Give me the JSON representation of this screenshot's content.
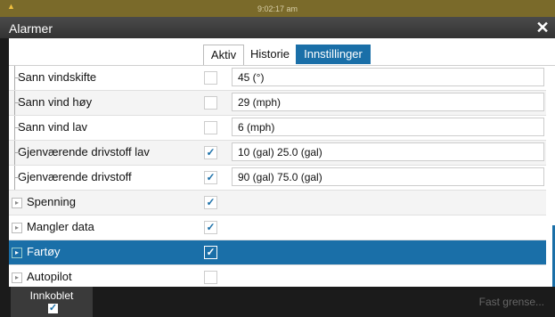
{
  "status_bar": {
    "time": "9:02:17 am",
    "warning_icon": "warning-icon"
  },
  "window": {
    "title": "Alarmer",
    "close_icon": "close-icon"
  },
  "tabs": [
    {
      "label": "Aktiv"
    },
    {
      "label": "Historie"
    },
    {
      "label": "Innstillinger",
      "active": true
    }
  ],
  "rows": [
    {
      "label": "Sann vindskifte",
      "checked": false,
      "value": "45 (°)",
      "sub": true
    },
    {
      "label": "Sann vind høy",
      "checked": false,
      "value": "29 (mph)",
      "sub": true
    },
    {
      "label": "Sann vind lav",
      "checked": false,
      "value": "6 (mph)",
      "sub": true
    },
    {
      "label": "Gjenværende drivstoff lav",
      "checked": true,
      "value": "10 (gal)  25.0 (gal)",
      "sub": true
    },
    {
      "label": "Gjenværende drivstoff",
      "checked": true,
      "value": "90 (gal)  75.0 (gal)",
      "sub": true
    },
    {
      "label": "Spenning",
      "checked": true,
      "value": ""
    },
    {
      "label": "Mangler data",
      "checked": true,
      "value": ""
    },
    {
      "label": "Fartøy",
      "checked": true,
      "value": "",
      "selected": true
    },
    {
      "label": "Autopilot",
      "checked": false,
      "value": ""
    }
  ],
  "bottom_bar": {
    "enabled_label": "Innkoblet",
    "enabled_checked": true,
    "fixed_limit_label": "Fast grense..."
  },
  "colors": {
    "accent": "#1a6fa8",
    "status_bar": "#7a6a2a"
  }
}
